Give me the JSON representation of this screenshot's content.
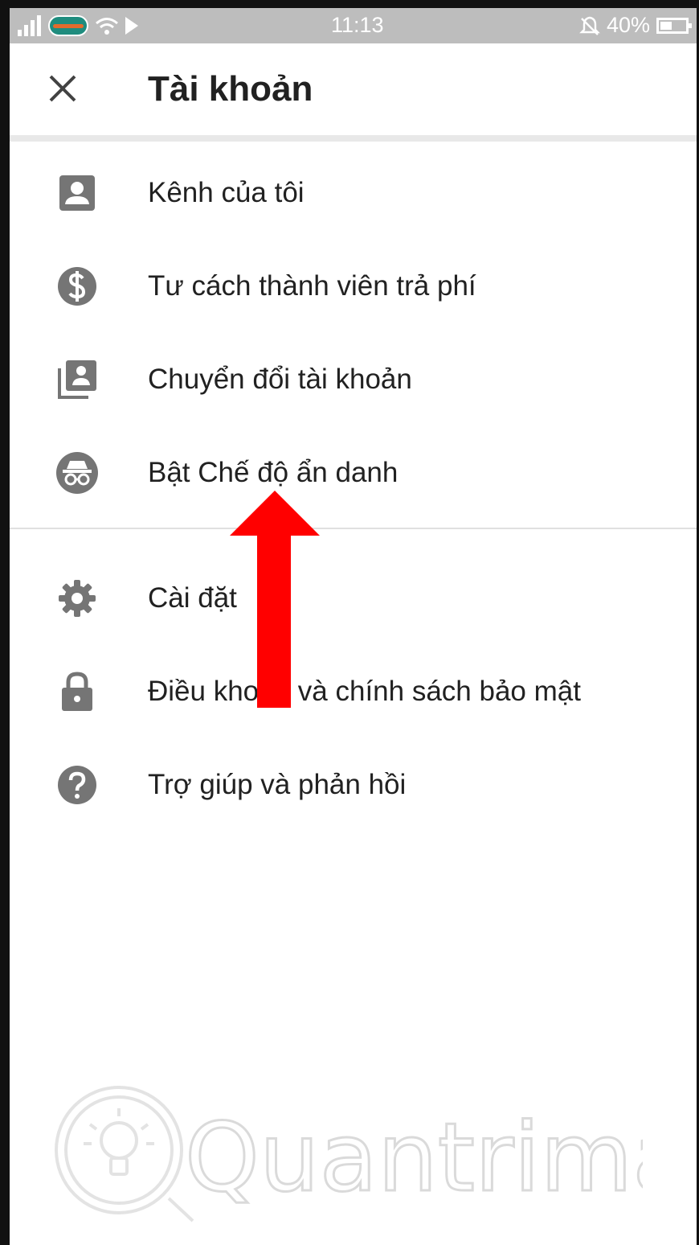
{
  "status_bar": {
    "time": "11:13",
    "battery": "40%"
  },
  "header": {
    "title": "Tài khoản"
  },
  "menu": {
    "group1": [
      {
        "label": "Kênh của tôi",
        "icon": "account-box-icon"
      },
      {
        "label": "Tư cách thành viên trả phí",
        "icon": "dollar-circle-icon"
      },
      {
        "label": "Chuyển đổi tài khoản",
        "icon": "switch-account-icon"
      },
      {
        "label": "Bật Chế độ ẩn danh",
        "icon": "incognito-icon"
      }
    ],
    "group2": [
      {
        "label": "Cài đặt",
        "icon": "gear-icon"
      },
      {
        "label": "Điều khoản và chính sách bảo mật",
        "icon": "lock-icon"
      },
      {
        "label": "Trợ giúp và phản hồi",
        "icon": "help-icon"
      }
    ]
  },
  "watermark": {
    "text": "Quantrimang"
  },
  "colors": {
    "icon": "#757575",
    "text": "#212121",
    "annotation_arrow": "#ff0000",
    "status_bar": "#bdbdbd"
  }
}
